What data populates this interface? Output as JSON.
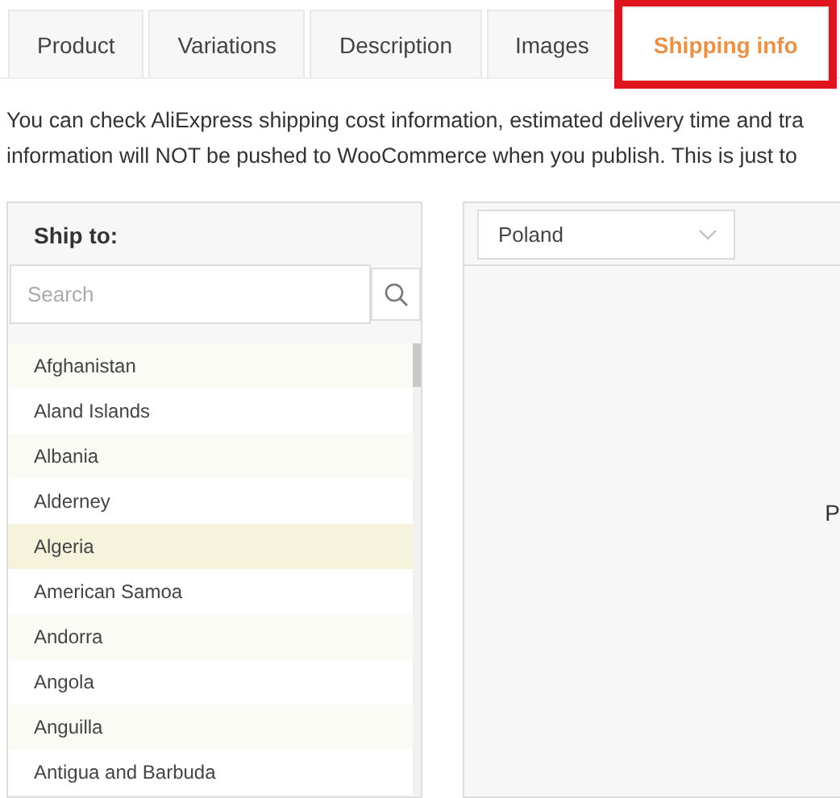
{
  "tabs": [
    {
      "label": "Product",
      "selected": false,
      "highlighted": false
    },
    {
      "label": "Variations",
      "selected": false,
      "highlighted": false
    },
    {
      "label": "Description",
      "selected": false,
      "highlighted": false
    },
    {
      "label": "Images",
      "selected": false,
      "highlighted": false
    },
    {
      "label": "Shipping info",
      "selected": true,
      "highlighted": true
    }
  ],
  "notice": [
    "You can check AliExpress shipping cost information, estimated delivery time and tra",
    "information will NOT be pushed to WooCommerce when you publish. This is just to"
  ],
  "ship_to": {
    "title": "Ship to:",
    "search": {
      "placeholder": "Search"
    },
    "countries": [
      {
        "name": "Afghanistan",
        "selected": false
      },
      {
        "name": "Aland Islands",
        "selected": false
      },
      {
        "name": "Albania",
        "selected": false
      },
      {
        "name": "Alderney",
        "selected": false
      },
      {
        "name": "Algeria",
        "selected": true
      },
      {
        "name": "American Samoa",
        "selected": false
      },
      {
        "name": "Andorra",
        "selected": false
      },
      {
        "name": "Angola",
        "selected": false
      },
      {
        "name": "Anguilla",
        "selected": false
      },
      {
        "name": "Antigua and Barbuda",
        "selected": false
      }
    ]
  },
  "shipping_panel": {
    "country_select": {
      "value": "Poland"
    },
    "message": "P"
  }
}
